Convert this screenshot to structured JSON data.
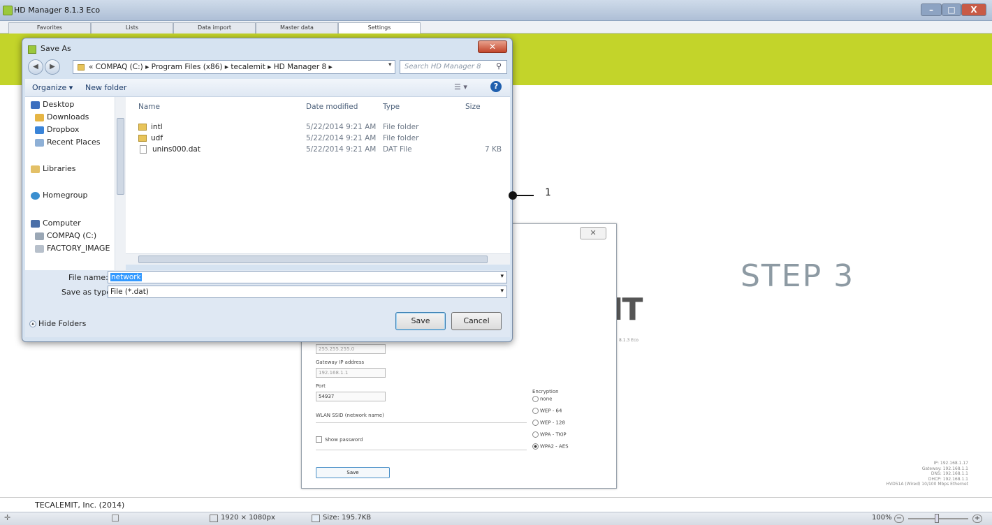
{
  "app": {
    "title": "HD Manager 8.1.3  Eco",
    "tabs": [
      "Favorites",
      "Lists",
      "Data import",
      "Master data",
      "Settings"
    ],
    "active_tab": "Settings",
    "footer": "TECALEMIT, Inc. (2014)"
  },
  "background": {
    "step_label": "STEP 3",
    "logo_fragment": "IT",
    "version_fragment": "8.1.3 Eco",
    "network_info": [
      "IP: 192.168.1.17",
      "Gateway: 192.168.1.1",
      "DNS: 192.168.1.1",
      "DHCP: 192.168.1.1",
      "HVD51A (Wired) 10/100 Mbps Ethernet"
    ]
  },
  "network_dialog": {
    "close_glyph": "✕",
    "subnet_value": "255.255.255.0",
    "gateway_label": "Gateway IP address",
    "gateway_value": "192.168.1.1",
    "port_label": "Port",
    "port_value": "54937",
    "ssid_label": "WLAN SSID (network name)",
    "show_password_label": "Show password",
    "encryption_label": "Encryption",
    "encryption_options": [
      "none",
      "WEP - 64",
      "WEP - 128",
      "WPA - TKIP",
      "WPA2 - AES"
    ],
    "encryption_selected": "WPA2 - AES",
    "save_label": "Save"
  },
  "save_as": {
    "title": "Save As",
    "close_glyph": "✕",
    "breadcrumb": "«  COMPAQ (C:)  ▸  Program Files (x86)  ▸  tecalemit  ▸  HD Manager 8  ▸",
    "search_placeholder": "Search HD Manager 8",
    "organize_label": "Organize ▾",
    "new_folder_label": "New folder",
    "nav_items": [
      "Desktop",
      "Downloads",
      "Dropbox",
      "Recent Places",
      "Libraries",
      "Homegroup",
      "Computer",
      "COMPAQ (C:)",
      "FACTORY_IMAGE"
    ],
    "columns": [
      "Name",
      "Date modified",
      "Type",
      "Size"
    ],
    "files": [
      {
        "name": "intl",
        "date": "5/22/2014 9:21 AM",
        "type": "File folder",
        "size": ""
      },
      {
        "name": "udf",
        "date": "5/22/2014 9:21 AM",
        "type": "File folder",
        "size": ""
      },
      {
        "name": "unins000.dat",
        "date": "5/22/2014 9:21 AM",
        "type": "DAT File",
        "size": "7 KB"
      }
    ],
    "file_name_label": "File name:",
    "file_name_value": "network",
    "save_type_label": "Save as type:",
    "save_type_value": "File (*.dat)",
    "hide_folders_label": "Hide Folders",
    "save_label": "Save",
    "cancel_label": "Cancel"
  },
  "callout": {
    "number": "1"
  },
  "statusbar": {
    "dimensions": "1920 × 1080px",
    "size": "Size: 195.7KB",
    "zoom": "100%"
  }
}
